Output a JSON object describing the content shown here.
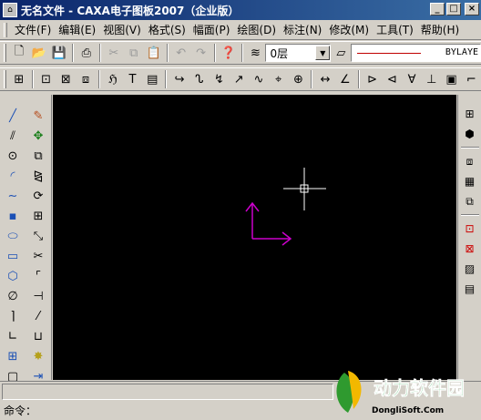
{
  "window": {
    "title": "无名文件 - CAXA电子图板2007（企业版）",
    "controls": [
      "_",
      "□",
      "×"
    ]
  },
  "menu": [
    "文件(F)",
    "编辑(E)",
    "视图(V)",
    "格式(S)",
    "幅面(P)",
    "绘图(D)",
    "标注(N)",
    "修改(M)",
    "工具(T)",
    "帮助(H)"
  ],
  "toolbar": {
    "layer_value": "0层",
    "linetype_value": "BYLAYE"
  },
  "command": {
    "prompt": "命令："
  },
  "watermark": {
    "text": "动力软件园",
    "subtext": "DongliSoft.Com"
  },
  "colors": {
    "canvas": "#000000",
    "ucs_axis": "#cc00cc",
    "crosshair": "#ffffff",
    "linetype_swatch": "#c00000"
  }
}
